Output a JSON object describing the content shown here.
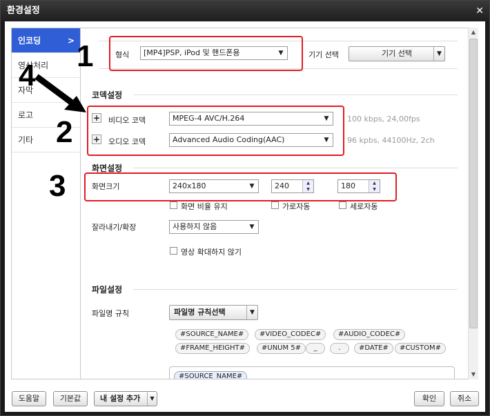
{
  "window": {
    "title": "환경설정",
    "close": "✕"
  },
  "sidebar": {
    "items": [
      {
        "label": "인코딩",
        "chev": ">"
      },
      {
        "label": "영상처리"
      },
      {
        "label": "자막"
      },
      {
        "label": "로고"
      },
      {
        "label": "기타"
      }
    ]
  },
  "format": {
    "label": "형식",
    "value": "[MP4]PSP, iPod 및 핸드폰용",
    "device_label": "기기 선택",
    "device_button": "기기 선택"
  },
  "codec": {
    "title": "코덱설정",
    "video_label": "비디오 코덱",
    "video_value": "MPEG-4 AVC/H.264",
    "video_info": "100 kbps, 24,00fps",
    "audio_label": "오디오 코덱",
    "audio_value": "Advanced Audio Coding(AAC)",
    "audio_info": "96 kpbs, 44100Hz, 2ch"
  },
  "screen": {
    "title": "화면설정",
    "size_label": "화면크기",
    "size_value": "240x180",
    "width": "240",
    "height": "180",
    "keep_ratio": "화면 비율 유지",
    "auto_width": "가로자동",
    "auto_height": "세로자동",
    "crop_label": "잘라내기/확장",
    "crop_value": "사용하지 않음",
    "no_zoom": "영상 확대하지 않기"
  },
  "file": {
    "title": "파일설정",
    "rule_label": "파일명 규칙",
    "rule_button": "파일명 규칙선택",
    "tags_row1": [
      "#SOURCE_NAME#",
      "#VIDEO_CODEC#",
      "#AUDIO_CODEC#"
    ],
    "tags_row2": [
      "#FRAME_HEIGHT#",
      "#UNUM 5#",
      "_",
      ".",
      "#DATE#",
      "#CUSTOM#"
    ],
    "field_tag": "#SOURCE_NAME#"
  },
  "annotations": {
    "n1": "1",
    "n2": "2",
    "n3": "3",
    "n4": "4"
  },
  "buttons": {
    "help": "도움말",
    "default": "기본값",
    "add_setting": "내 설정 추가",
    "ok": "확인",
    "cancel": "취소"
  },
  "colors": {
    "sidebar_active": "#2f5ed7",
    "highlight_box": "#e21a22"
  }
}
